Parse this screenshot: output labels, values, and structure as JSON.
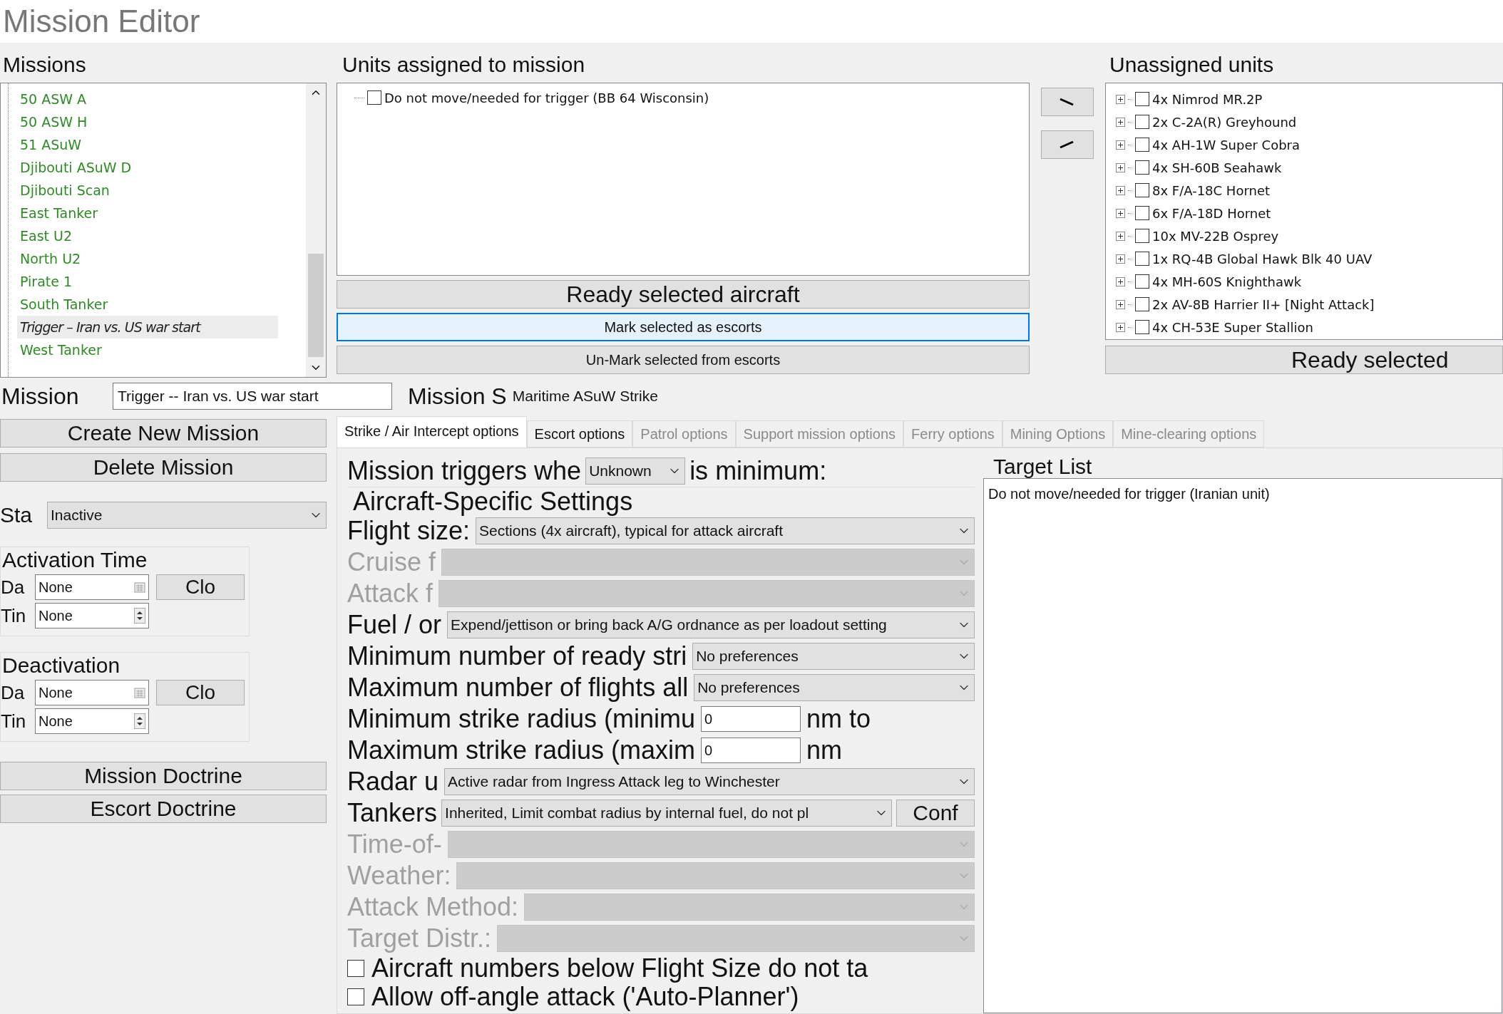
{
  "window": {
    "title": "Mission Editor"
  },
  "missions": {
    "heading": "Missions",
    "items": [
      {
        "label": "50 ASW A",
        "selected": false
      },
      {
        "label": "50 ASW H",
        "selected": false
      },
      {
        "label": "51 ASuW",
        "selected": false
      },
      {
        "label": "Djibouti ASuW D",
        "selected": false
      },
      {
        "label": "Djibouti Scan",
        "selected": false
      },
      {
        "label": "East Tanker",
        "selected": false
      },
      {
        "label": "East U2",
        "selected": false
      },
      {
        "label": "North U2",
        "selected": false
      },
      {
        "label": "Pirate 1",
        "selected": false
      },
      {
        "label": "South Tanker",
        "selected": false
      },
      {
        "label": "Trigger – Iran vs. US war start",
        "selected": true
      },
      {
        "label": "West Tanker",
        "selected": false
      }
    ]
  },
  "assigned": {
    "heading": "Units assigned to mission",
    "items": [
      {
        "label": "Do not move/needed for trigger (BB 64 Wisconsin)",
        "checked": false
      }
    ],
    "buttons": [
      {
        "label": "Ready selected aircraft",
        "kind": "large",
        "focused": false
      },
      {
        "label": "Mark selected as escorts",
        "kind": "small",
        "focused": true
      },
      {
        "label": "Un-Mark selected from escorts",
        "kind": "small",
        "focused": false
      }
    ]
  },
  "unassigned": {
    "heading": "Unassigned units",
    "items": [
      {
        "label": "4x Nimrod MR.2P",
        "checked": false
      },
      {
        "label": "2x C-2A(R) Greyhound",
        "checked": false
      },
      {
        "label": "4x AH-1W Super Cobra",
        "checked": false
      },
      {
        "label": "4x SH-60B Seahawk",
        "checked": false
      },
      {
        "label": "8x F/A-18C Hornet",
        "checked": false
      },
      {
        "label": "6x F/A-18D Hornet",
        "checked": false
      },
      {
        "label": "10x MV-22B Osprey",
        "checked": false
      },
      {
        "label": "1x RQ-4B Global Hawk Blk 40 UAV",
        "checked": false
      },
      {
        "label": "4x MH-60S Knighthawk",
        "checked": false
      },
      {
        "label": "2x AV-8B Harrier II+ [Night Attack]",
        "checked": false
      },
      {
        "label": "4x CH-53E Super Stallion",
        "checked": false
      }
    ],
    "button": "Ready selected"
  },
  "mission_name": {
    "label": "Mission",
    "value": "Trigger -- Iran vs. US war start"
  },
  "mission_type": {
    "label": "Mission S",
    "value": "Maritime ASuW Strike"
  },
  "left_buttons": [
    "Create New Mission",
    "Delete Mission"
  ],
  "status": {
    "label": "Sta",
    "value": "Inactive"
  },
  "time_groups": [
    {
      "title": "Activation Time",
      "date_label": "Da",
      "date": "None",
      "time_label": "Tin",
      "time": "None",
      "button": "Clo"
    },
    {
      "title": "Deactivation",
      "date_label": "Da",
      "date": "None",
      "time_label": "Tin",
      "time": "None",
      "button": "Clo"
    }
  ],
  "doctrine_buttons": [
    "Mission Doctrine",
    "Escort Doctrine"
  ],
  "tabs": [
    {
      "label": "Strike / Air Intercept options",
      "selected": true,
      "disabled": false
    },
    {
      "label": "Escort options",
      "selected": false,
      "disabled": false
    },
    {
      "label": "Patrol options",
      "selected": false,
      "disabled": true
    },
    {
      "label": "Support mission options",
      "selected": false,
      "disabled": true
    },
    {
      "label": "Ferry options",
      "selected": false,
      "disabled": true
    },
    {
      "label": "Mining Options",
      "selected": false,
      "disabled": true
    },
    {
      "label": "Mine-clearing options",
      "selected": false,
      "disabled": true
    }
  ],
  "form": [
    {
      "kind": "trigger",
      "label": "Mission triggers whe",
      "value": "Unknown",
      "suffix": "is minimum:"
    },
    {
      "kind": "group",
      "label": "Aircraft-Specific Settings"
    },
    {
      "kind": "combo",
      "label": "Flight size:",
      "value": "Sections (4x aircraft), typical for attack aircraft",
      "disabled": false
    },
    {
      "kind": "combo",
      "label": "Cruise f",
      "disabled": true
    },
    {
      "kind": "combo",
      "label": "Attack f",
      "disabled": true
    },
    {
      "kind": "combo",
      "label": "Fuel / or",
      "value": "Expend/jettison or bring back A/G ordnance as per loadout setting",
      "disabled": false
    },
    {
      "kind": "short_combo",
      "label": "Minimum number of ready stri",
      "value": "No preferences"
    },
    {
      "kind": "short_combo",
      "label": "Maximum number of flights all",
      "value": "No preferences"
    },
    {
      "kind": "number",
      "label": "Minimum strike radius (minimu",
      "value": "0",
      "suffix": "nm to"
    },
    {
      "kind": "number",
      "label": "Maximum strike radius (maxim",
      "value": "0",
      "suffix": "nm"
    },
    {
      "kind": "combo",
      "label": "Radar u",
      "value": "Active radar from Ingress Attack leg to Winchester",
      "disabled": false
    },
    {
      "kind": "combo_button",
      "label": "Tankers",
      "value": "Inherited, Limit combat radius by internal fuel, do not pl",
      "button": "Conf"
    },
    {
      "kind": "combo",
      "label": "Time-of-",
      "disabled": true
    },
    {
      "kind": "combo",
      "label": "Weather:",
      "disabled": true
    },
    {
      "kind": "combo",
      "label": "Attack Method:",
      "disabled": true
    },
    {
      "kind": "combo",
      "label": "Target Distr.:",
      "disabled": true
    },
    {
      "kind": "checkbox",
      "label": "Aircraft numbers below Flight Size do not ta",
      "checked": false
    },
    {
      "kind": "checkbox",
      "label": "Allow off-angle attack ('Auto-Planner')",
      "checked": false
    }
  ],
  "target_list": {
    "title": "Target List",
    "items": [
      "Do not move/needed for trigger (Iranian unit)"
    ]
  }
}
